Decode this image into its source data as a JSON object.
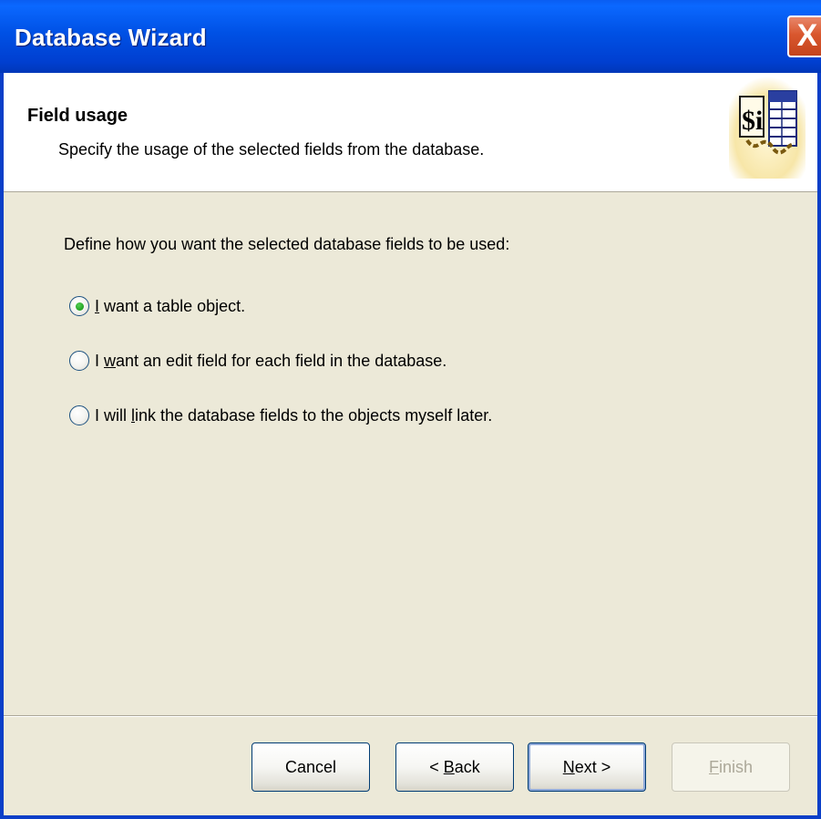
{
  "window": {
    "title": "Database Wizard",
    "close_label": "X"
  },
  "header": {
    "title": "Field usage",
    "subtitle": "Specify the usage of the selected fields from the database.",
    "art_icon": "database-wizard-icon"
  },
  "content": {
    "prompt": "Define how you want the selected database fields to be used:",
    "options": [
      {
        "prefix": "",
        "mnemonic": "I",
        "suffix": " want a table object.",
        "selected": true
      },
      {
        "prefix": "I ",
        "mnemonic": "w",
        "suffix": "ant an edit field for each field in the database.",
        "selected": false
      },
      {
        "prefix": "I will ",
        "mnemonic": "l",
        "suffix": "ink the database fields to the objects myself later.",
        "selected": false
      }
    ]
  },
  "buttons": {
    "cancel": {
      "label": "Cancel"
    },
    "back": {
      "prefix": "< ",
      "mnemonic": "B",
      "suffix": "ack"
    },
    "next": {
      "prefix": "",
      "mnemonic": "N",
      "suffix": "ext >"
    },
    "finish": {
      "prefix": "",
      "mnemonic": "F",
      "suffix": "inish",
      "disabled": true
    }
  },
  "colors": {
    "titlebar": "#0051e5",
    "face": "#ece9d8",
    "radio_selected": "#21a121"
  }
}
